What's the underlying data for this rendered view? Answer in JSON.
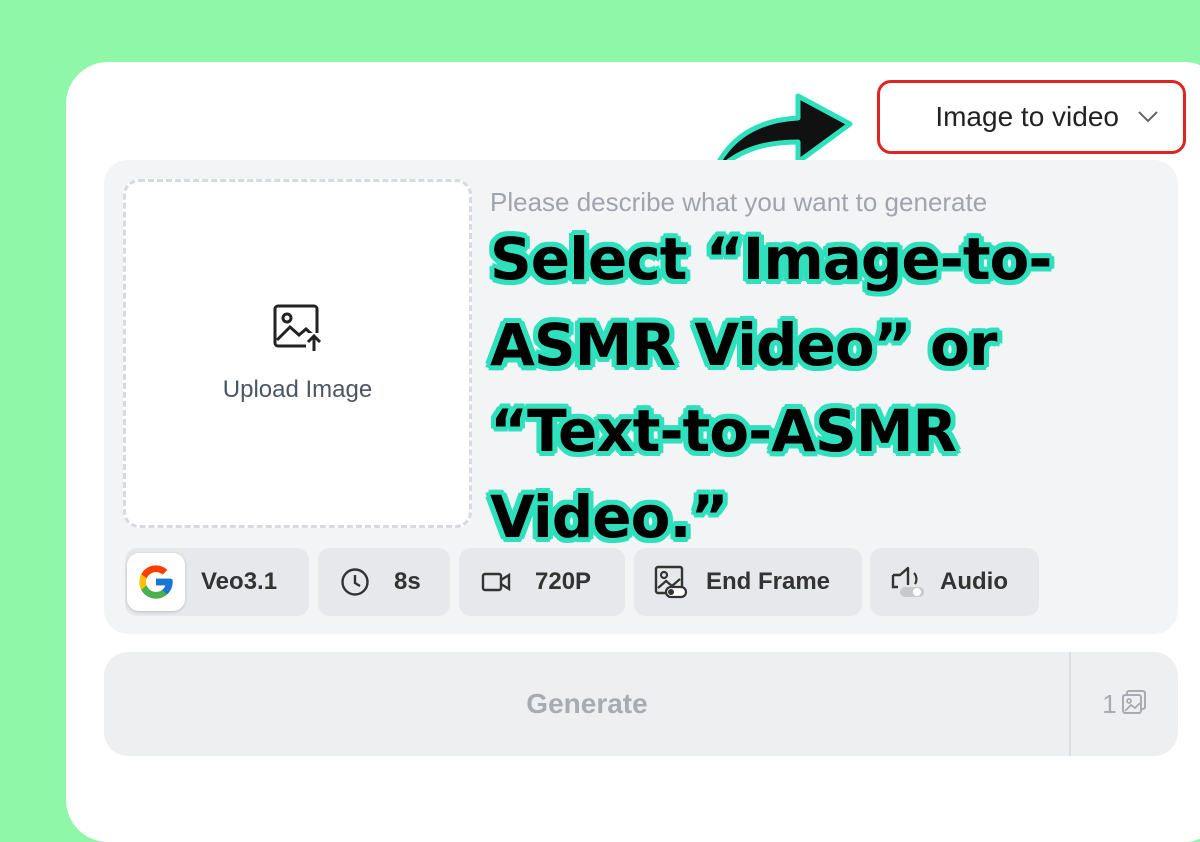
{
  "mode_select": {
    "label": "Image to video"
  },
  "upload": {
    "label": "Upload Image"
  },
  "prompt": {
    "placeholder": "Please describe what you want to generate"
  },
  "annotation": {
    "lines": [
      "Select “Image-to-",
      "ASMR Video” or",
      "“Text-to-ASMR",
      "Video.”"
    ]
  },
  "options": {
    "model": "Veo3.1",
    "duration": "8s",
    "resolution": "720P",
    "end_frame": "End Frame",
    "audio": "Audio"
  },
  "generate": {
    "label": "Generate",
    "count": "1"
  },
  "colors": {
    "background": "#8ef7a8",
    "highlight_border": "#e02424",
    "annotation_outline": "#2fe0bd"
  },
  "icons": [
    "chevron-down-icon",
    "curved-arrow-icon",
    "image-upload-icon",
    "google-logo-icon",
    "clock-icon",
    "video-camera-icon",
    "end-frame-icon",
    "audio-toggle-icon",
    "images-count-icon"
  ]
}
